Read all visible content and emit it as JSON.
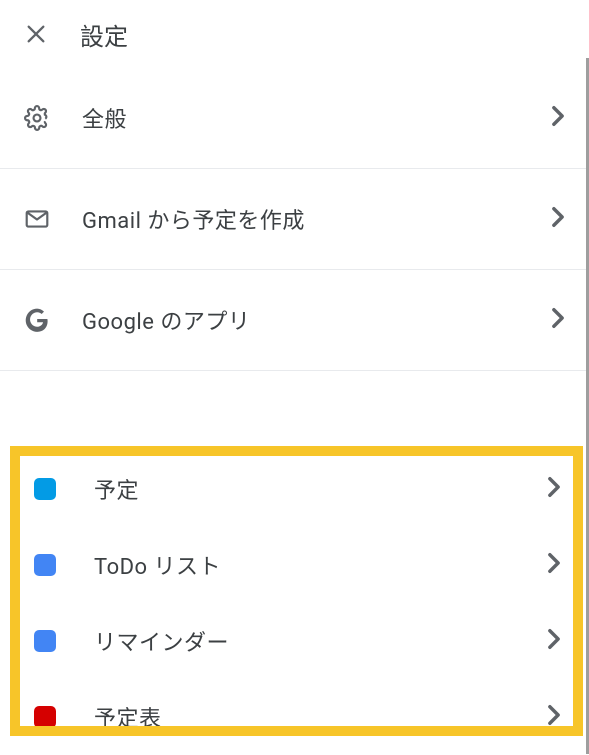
{
  "header": {
    "title": "設定"
  },
  "settings": [
    {
      "id": "general",
      "label": "全般",
      "icon": "gear"
    },
    {
      "id": "gmail",
      "label": "Gmail から予定を作成",
      "icon": "mail"
    },
    {
      "id": "google-apps",
      "label": "Google のアプリ",
      "icon": "google"
    }
  ],
  "calendars": [
    {
      "id": "events",
      "label": "予定",
      "color": "#039be5"
    },
    {
      "id": "todo",
      "label": "ToDo リスト",
      "color": "#4285f4"
    },
    {
      "id": "reminders",
      "label": "リマインダー",
      "color": "#4285f4"
    },
    {
      "id": "schedule",
      "label": "予定表",
      "color": "#d50000"
    }
  ]
}
